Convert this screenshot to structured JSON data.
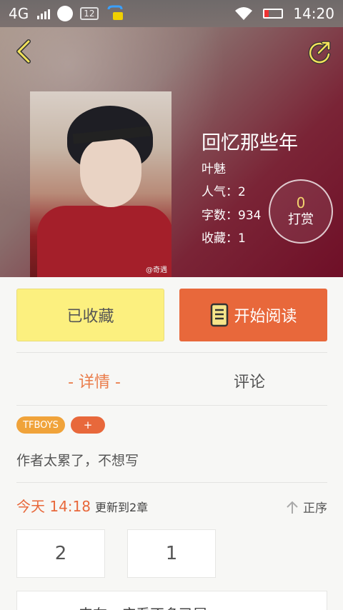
{
  "status_bar": {
    "network": "4G",
    "notification_badge": "12",
    "time": "14:20"
  },
  "book": {
    "title": "回忆那些年",
    "author": "叶魅",
    "popularity_label": "人气：2",
    "word_count_label": "字数：934",
    "favorites_label": "收藏：1",
    "reward_count": "0",
    "reward_label": "打赏",
    "cover_watermark": "@奇遇"
  },
  "actions": {
    "favorited_label": "已收藏",
    "start_reading_label": "开始阅读"
  },
  "tabs": [
    {
      "label": "- 详情 -",
      "active": true
    },
    {
      "label": "评论",
      "active": false
    }
  ],
  "tags": {
    "tfboys": "TFBOYS",
    "add": "+"
  },
  "description": "作者太累了，不想写",
  "update": {
    "time": "今天 14:18",
    "info": "更新到2章",
    "sort_label": "正序"
  },
  "chapters": [
    "2",
    "1"
  ],
  "bottom_card_text": "来在…庙看不多已尾",
  "colors": {
    "accent_orange": "#e8683b",
    "favorite_yellow": "#fcf07f",
    "reward_gold": "#f3d36e"
  }
}
